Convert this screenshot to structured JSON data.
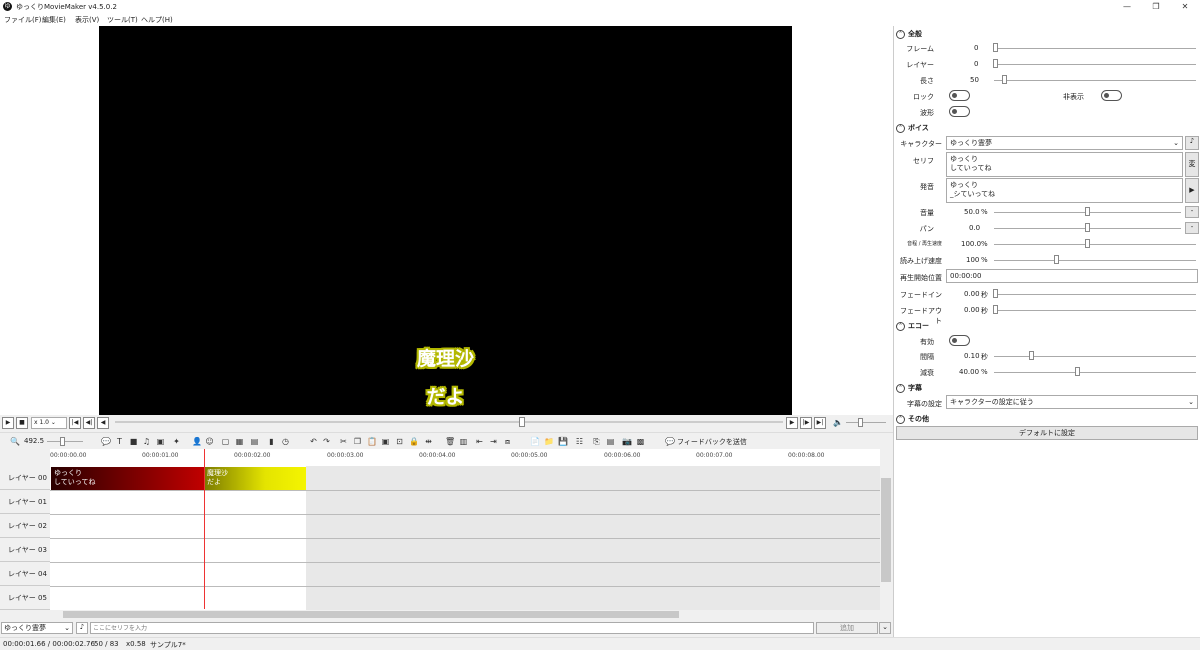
{
  "window": {
    "title": "ゆっくりMovieMaker v4.5.0.2",
    "controls": {
      "minimize": "—",
      "maximize": "❐",
      "close": "✕"
    }
  },
  "menu": [
    "ファイル(F)",
    "編集(E)",
    "表示(V)",
    "ツール(T)",
    "ヘルプ(H)"
  ],
  "preview": {
    "subtitle_line1": "魔理沙",
    "subtitle_line2": "だよ"
  },
  "playback": {
    "speed": "x 1.0"
  },
  "toolbar": {
    "zoom": "492.5",
    "feedback": "フィードバックを送信"
  },
  "ruler": {
    "ticks": [
      "00:00:00.00",
      "00:00:01.00",
      "00:00:02.00",
      "00:00:03.00",
      "00:00:04.00",
      "00:00:05.00",
      "00:00:06.00",
      "00:00:07.00",
      "00:00:08.00"
    ]
  },
  "layers": [
    "レイヤー 00",
    "レイヤー 01",
    "レイヤー 02",
    "レイヤー 03",
    "レイヤー 04",
    "レイヤー 05"
  ],
  "clips": [
    {
      "line1": "ゆっくり",
      "line2": "していってね"
    },
    {
      "line1": "魔理沙",
      "line2": "だよ"
    }
  ],
  "inputbar": {
    "character": "ゆっくり霊夢",
    "placeholder": "ここにセリフを入力",
    "add_label": "追加"
  },
  "status": {
    "time": "00:00:01.66 / 00:00:02.76",
    "frames": "50 / 83",
    "zoom": "x0.58",
    "project": "サンプル7*"
  },
  "panel": {
    "general": {
      "title": "全般",
      "frame_label": "フレーム",
      "frame_value": "0",
      "layer_label": "レイヤー",
      "layer_value": "0",
      "length_label": "長さ",
      "length_value": "50",
      "lock_label": "ロック",
      "hide_label": "非表示",
      "waveform_label": "波形"
    },
    "voice": {
      "title": "ボイス",
      "character_label": "キャラクター",
      "character_value": "ゆっくり霊夢",
      "serif_label": "セリフ",
      "serif_value_1": "ゆっくり",
      "serif_value_2": "していってね",
      "pron_label": "発音",
      "pron_value_1": "ゆっくり",
      "pron_value_2": "_シていってね",
      "volume_label": "音量",
      "volume_value": "50.0",
      "volume_unit": "%",
      "pan_label": "パン",
      "pan_value": "0.0",
      "pitch_label": "音程 / 再生速度",
      "pitch_value": "100.0",
      "pitch_unit": "%",
      "readspeed_label": "読み上げ速度",
      "readspeed_value": "100",
      "readspeed_unit": "%",
      "start_label": "再生開始位置",
      "start_value": "00:00:00",
      "fadein_label": "フェードイン",
      "fadein_value": "0.00",
      "fadein_unit": "秒",
      "fadeout_label": "フェードアウト",
      "fadeout_value": "0.00",
      "fadeout_unit": "秒",
      "side_btn_1": "変",
      "side_btn_2": "▶",
      "side_btn_3": "-",
      "side_btn_4": "-"
    },
    "echo": {
      "title": "エコー",
      "enable_label": "有効",
      "interval_label": "間隔",
      "interval_value": "0.10",
      "interval_unit": "秒",
      "decay_label": "減衰",
      "decay_value": "40.00",
      "decay_unit": "%"
    },
    "subtitle": {
      "title": "字幕",
      "setting_label": "字幕の設定",
      "setting_value": "キャラクターの設定に従う"
    },
    "other": {
      "title": "その他",
      "default_button": "デフォルトに設定"
    }
  },
  "colors": {
    "clip1": "#9a0000",
    "clip2": "#e4e400",
    "playhead": "#ee3333",
    "subtitle_outline": "#b3b800"
  }
}
